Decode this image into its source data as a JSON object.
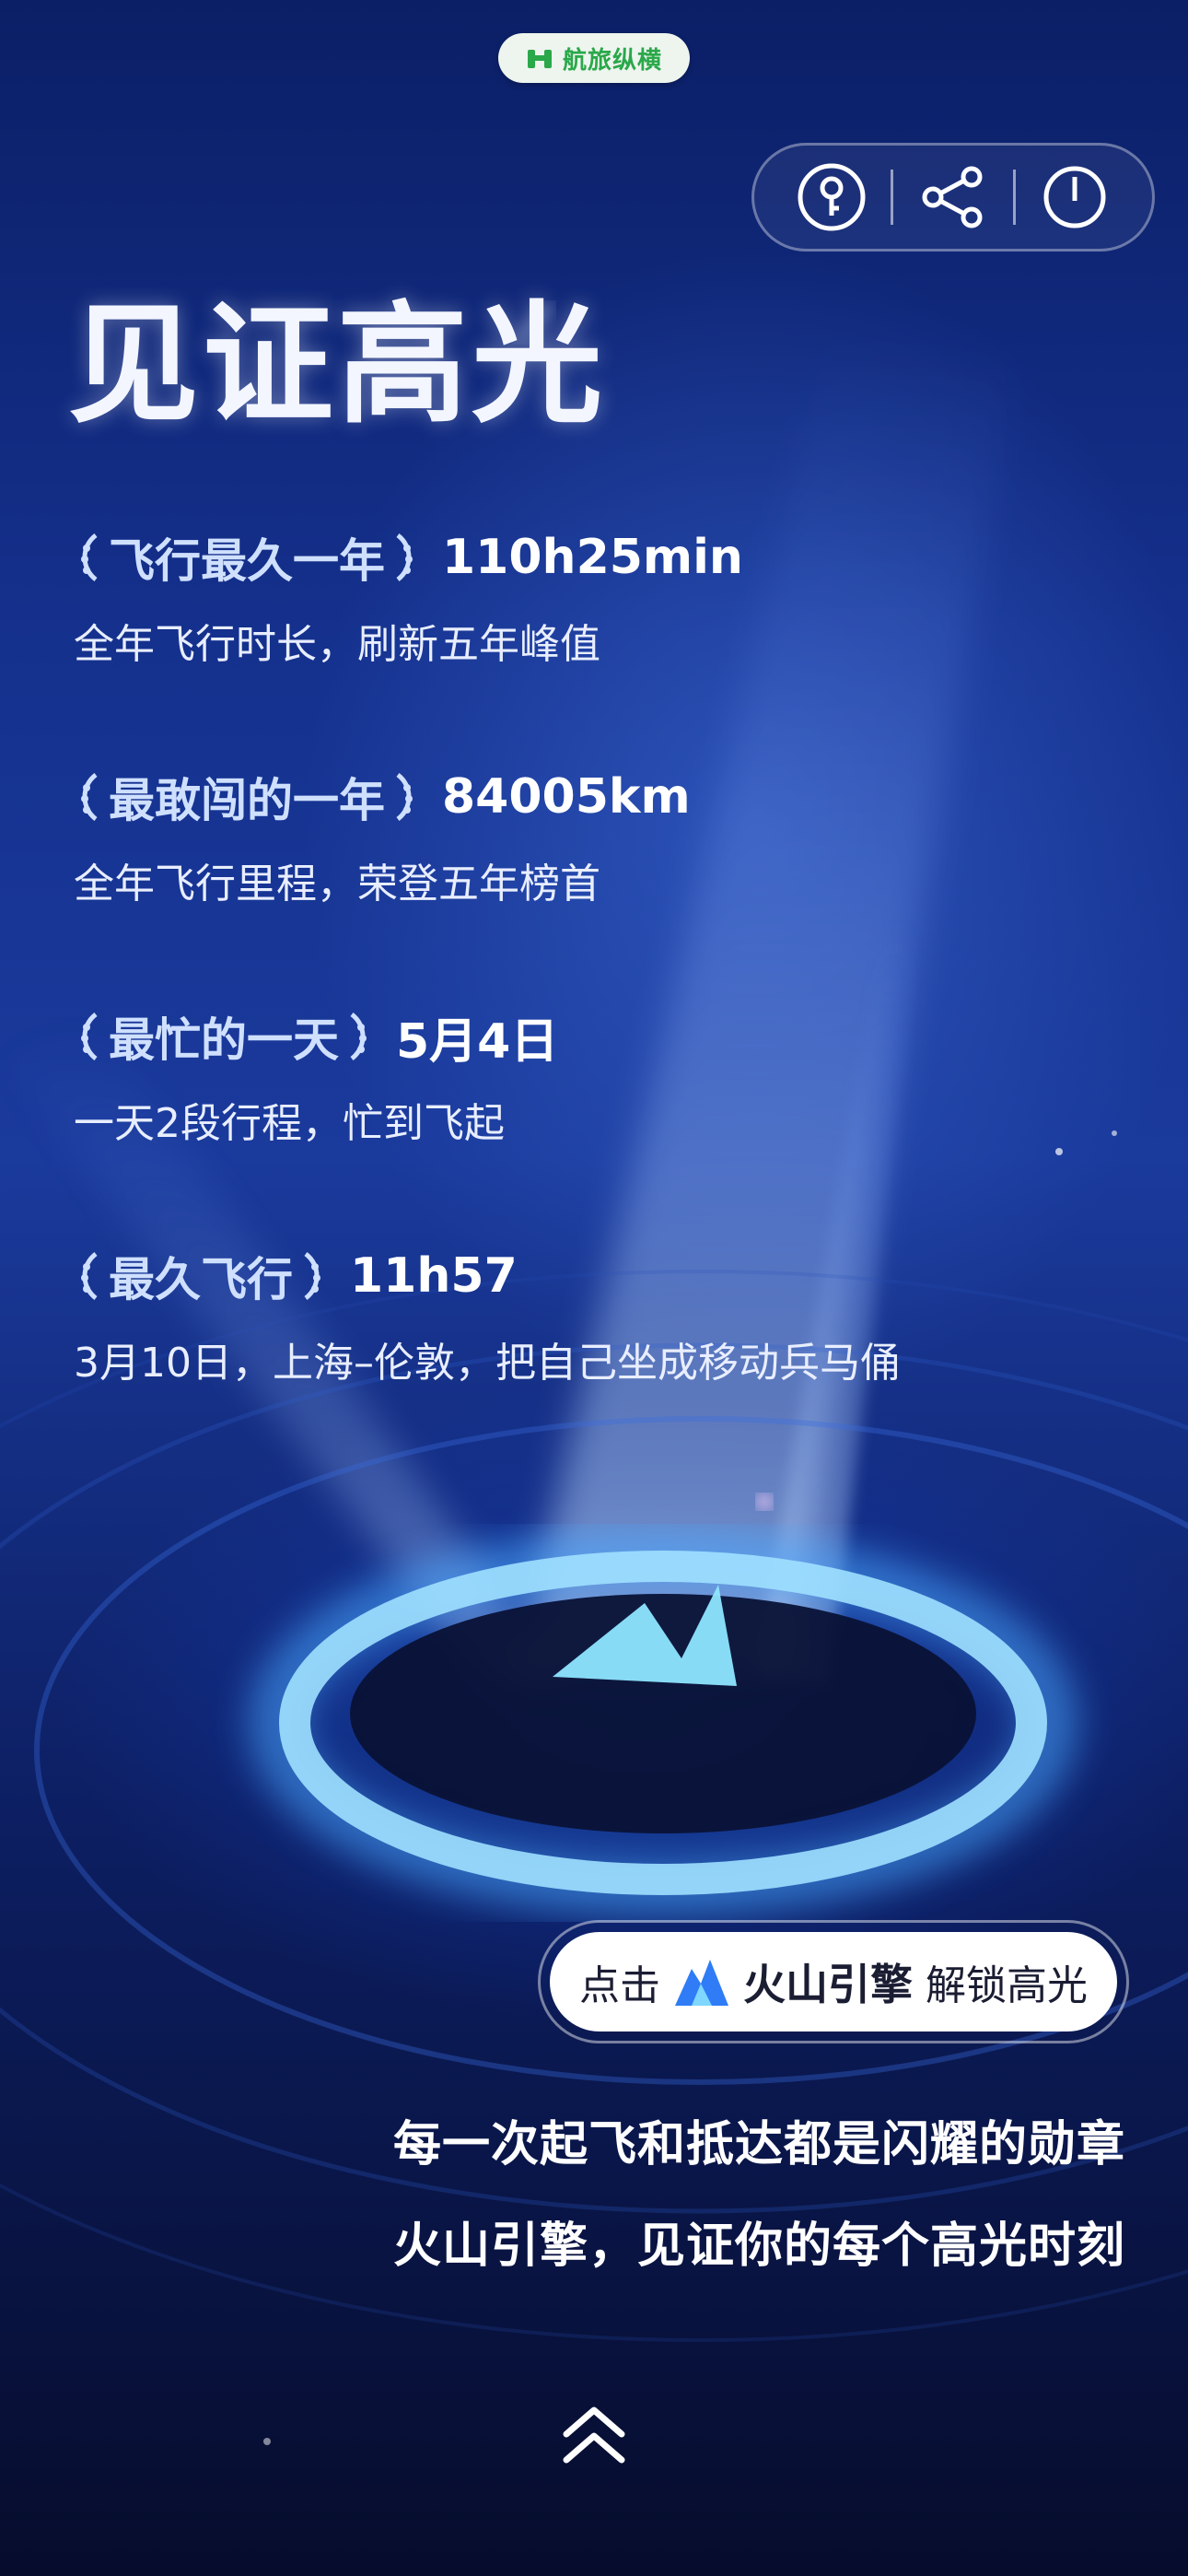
{
  "brand": {
    "name": "航旅纵横",
    "color": "#2aa84a",
    "icon": "brand-logo-icon"
  },
  "toolbar": {
    "items": [
      {
        "icon": "key-icon"
      },
      {
        "icon": "share-icon"
      },
      {
        "icon": "power-icon"
      }
    ]
  },
  "headline": "见证高光",
  "highlights": [
    {
      "title": "飞行最久一年",
      "value": "110h25min",
      "desc": "全年飞行时长，刷新五年峰值"
    },
    {
      "title": "最敢闯的一年",
      "value": "84005km",
      "desc": "全年飞行里程，荣登五年榜首"
    },
    {
      "title": "最忙的一天",
      "value": "5月4日",
      "desc": "一天2段行程，忙到飞起"
    },
    {
      "title": "最久飞行",
      "value": "11h57",
      "desc": "3月10日，上海–伦敦，把自己坐成移动兵马俑"
    }
  ],
  "unlock": {
    "prefix": "点击",
    "brand": "火山引擎",
    "suffix": "解锁高光",
    "icon": "volcano-engine-icon"
  },
  "footer": {
    "line1": "每一次起飞和抵达都是闪耀的勋章",
    "line2": "火山引擎，见证你的每个高光时刻"
  },
  "swipe": {
    "icon": "double-chevron-up-icon"
  },
  "colors": {
    "accent": "#cfe0ff",
    "bg_top": "#0b1f66",
    "bg_bottom": "#060c2c",
    "glow": "#3a8bff"
  }
}
